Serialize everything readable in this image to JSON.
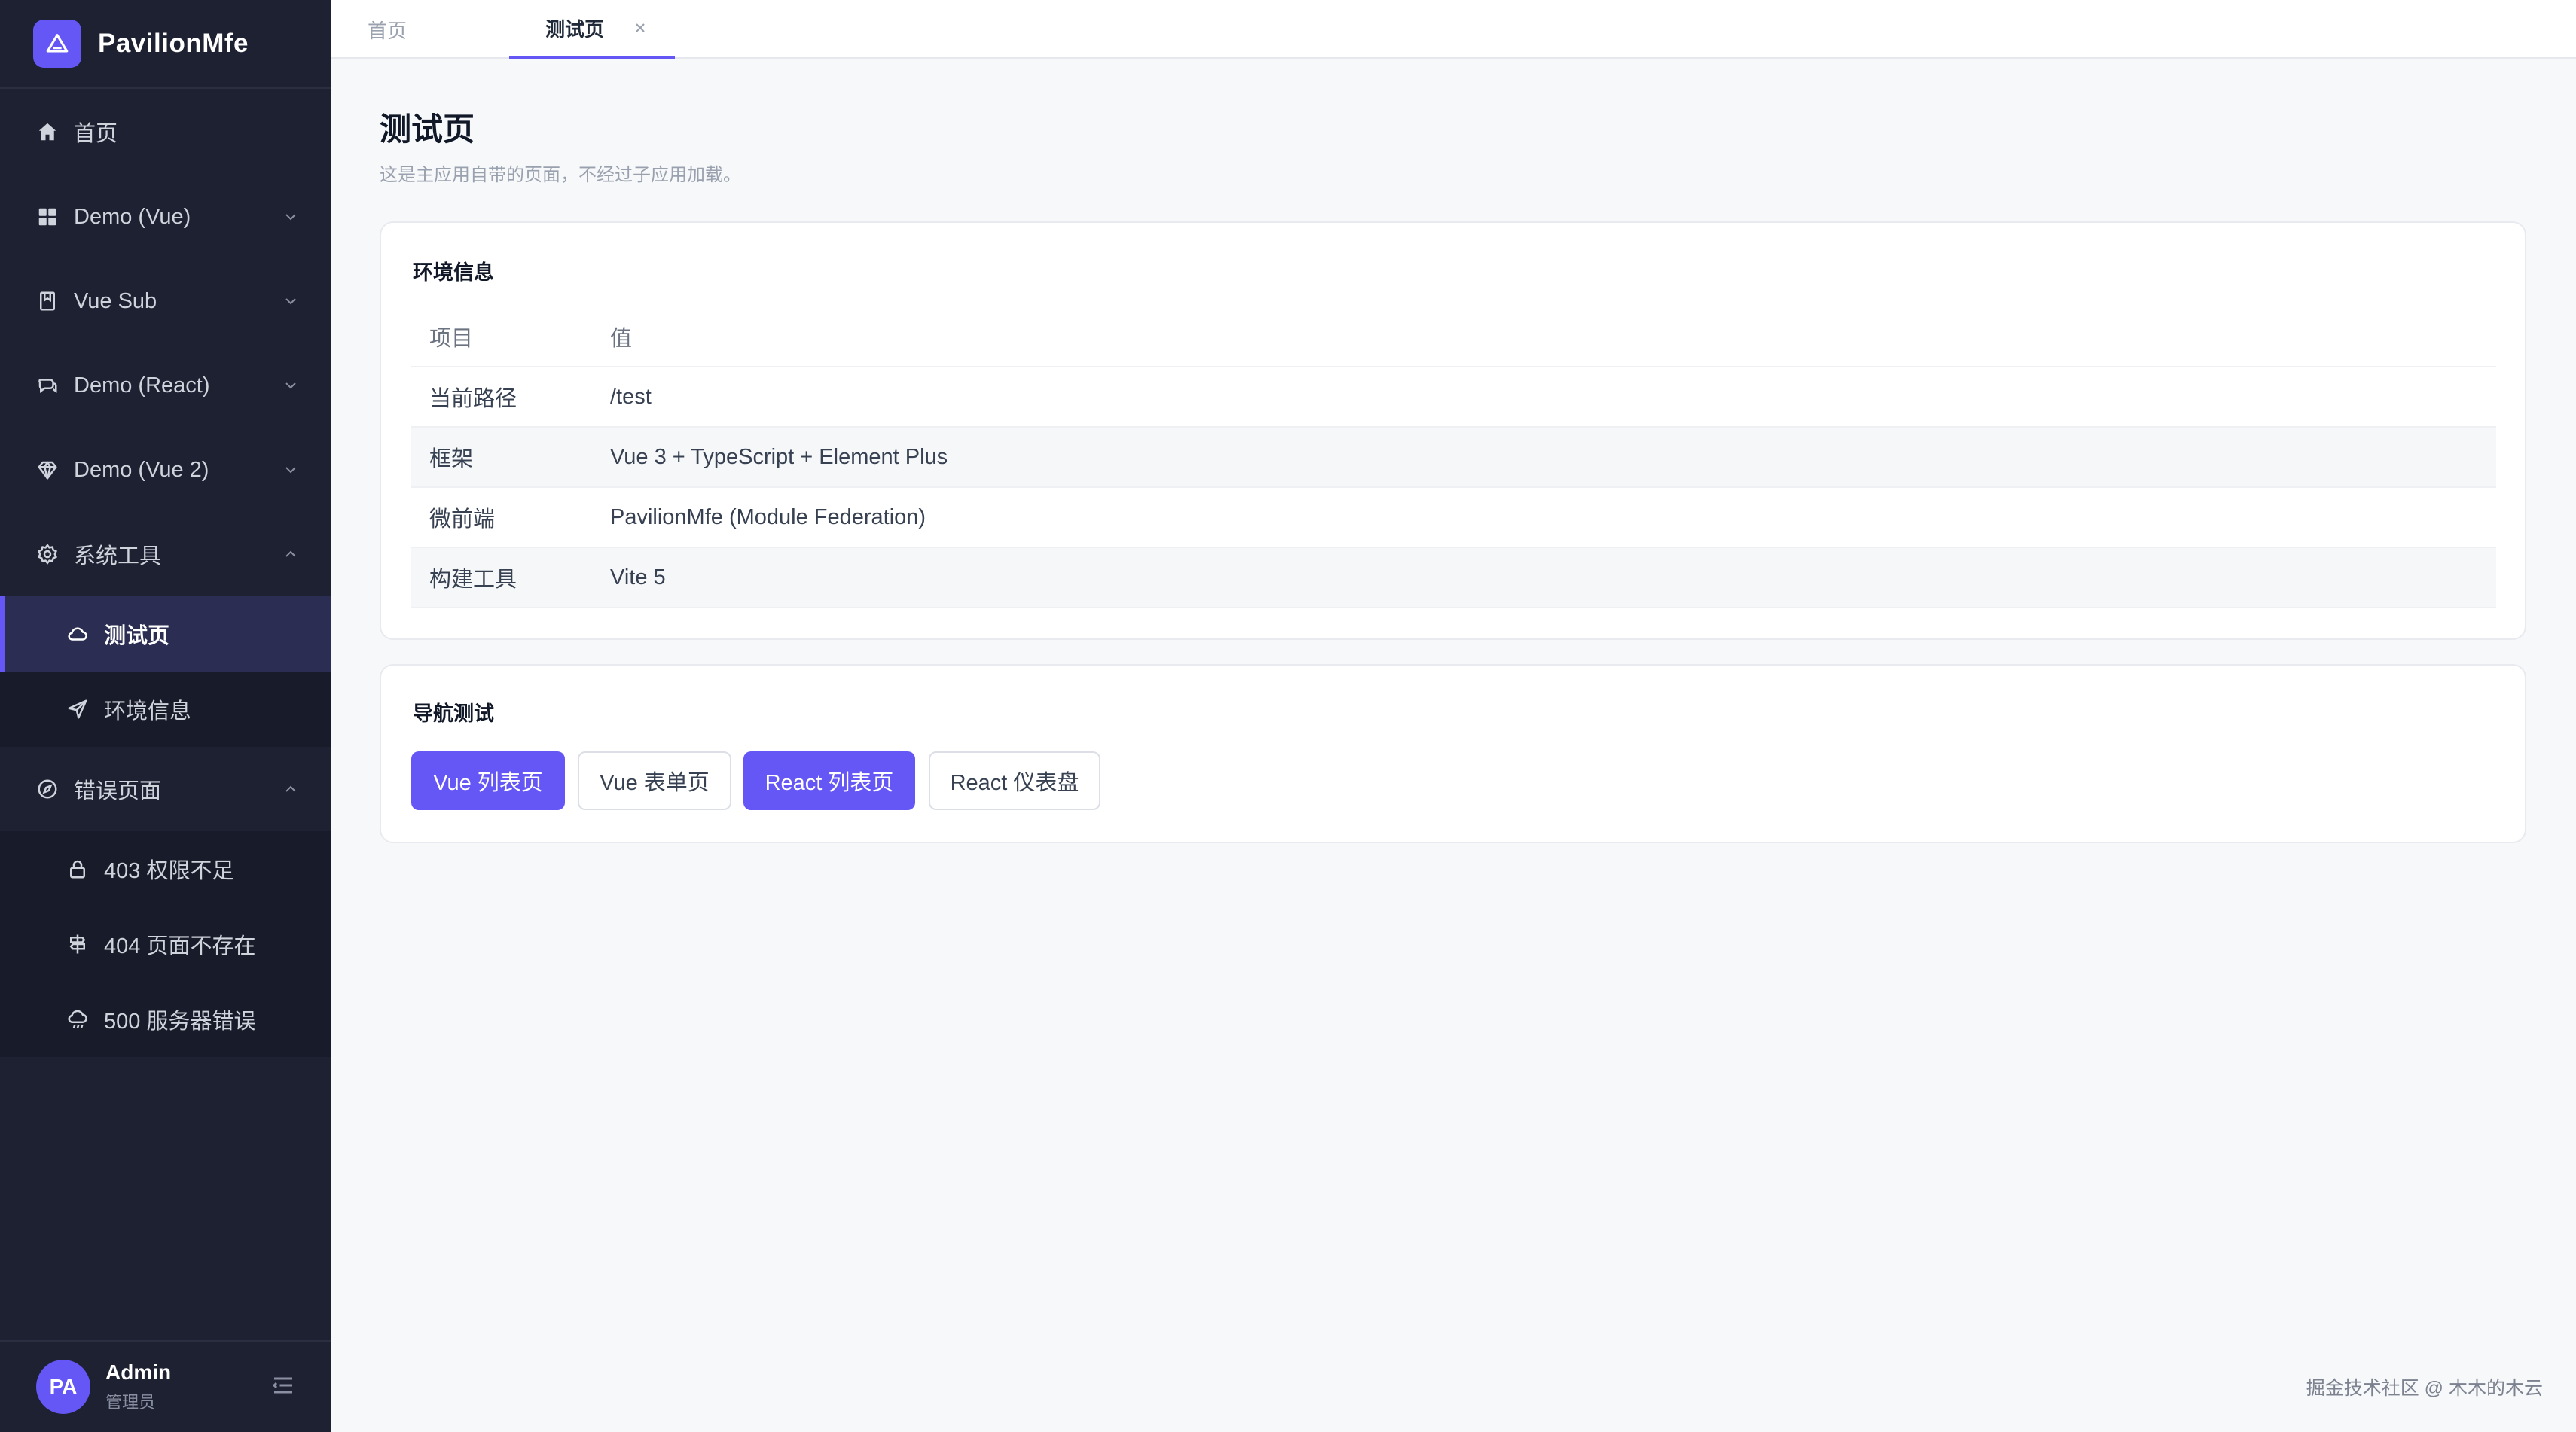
{
  "brand": {
    "name": "PavilionMfe",
    "logo_icon": "triangle-logo-icon"
  },
  "sidebar": {
    "items": [
      {
        "label": "首页",
        "icon": "home-icon",
        "expanded": null
      },
      {
        "label": "Demo (Vue)",
        "icon": "grid-icon",
        "expanded": false
      },
      {
        "label": "Vue Sub",
        "icon": "book-icon",
        "expanded": false
      },
      {
        "label": "Demo (React)",
        "icon": "chat-icon",
        "expanded": false
      },
      {
        "label": "Demo (Vue 2)",
        "icon": "diamond-icon",
        "expanded": false
      },
      {
        "label": "系统工具",
        "icon": "gear-icon",
        "expanded": true
      },
      {
        "label": "错误页面",
        "icon": "compass-icon",
        "expanded": true
      }
    ],
    "sub_system": [
      {
        "label": "测试页",
        "icon": "cloud-icon",
        "active": true
      },
      {
        "label": "环境信息",
        "icon": "send-icon",
        "active": false
      }
    ],
    "sub_errors": [
      {
        "label": "403 权限不足",
        "icon": "lock-icon"
      },
      {
        "label": "404 页面不存在",
        "icon": "signpost-icon"
      },
      {
        "label": "500 服务器错误",
        "icon": "cloud-rain-icon"
      }
    ]
  },
  "user": {
    "initials": "PA",
    "name": "Admin",
    "role": "管理员"
  },
  "tabs": [
    {
      "label": "首页",
      "active": false
    },
    {
      "label": "测试页",
      "active": true,
      "closable": true
    }
  ],
  "page": {
    "title": "测试页",
    "subtitle": "这是主应用自带的页面，不经过子应用加载。"
  },
  "env_card": {
    "title": "环境信息",
    "columns": [
      "项目",
      "值"
    ],
    "rows": [
      [
        "当前路径",
        "/test"
      ],
      [
        "框架",
        "Vue 3 + TypeScript + Element Plus"
      ],
      [
        "微前端",
        "PavilionMfe (Module Federation)"
      ],
      [
        "构建工具",
        "Vite 5"
      ]
    ]
  },
  "nav_card": {
    "title": "导航测试",
    "buttons": [
      {
        "label": "Vue 列表页",
        "style": "primary"
      },
      {
        "label": "Vue 表单页",
        "style": "plain"
      },
      {
        "label": "React 列表页",
        "style": "primary"
      },
      {
        "label": "React 仪表盘",
        "style": "plain"
      }
    ]
  },
  "watermark": "掘金技术社区 @ 木木的木云",
  "colors": {
    "accent": "#6557f5",
    "sidebar_bg": "#1e2132",
    "page_bg": "#f7f8fa"
  }
}
